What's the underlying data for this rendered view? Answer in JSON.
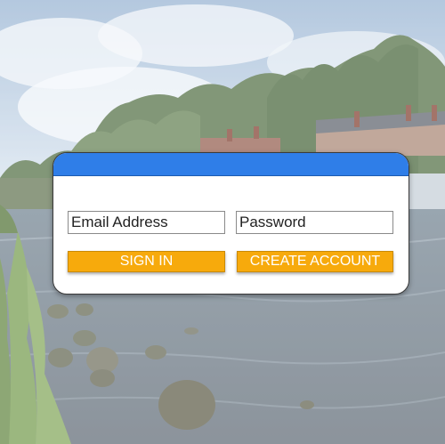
{
  "login": {
    "email_placeholder": "Email Address",
    "password_placeholder": "Password",
    "sign_in_label": "SIGN IN",
    "create_account_label": "CREATE ACCOUNT"
  },
  "colors": {
    "header_accent": "#2f7ee8",
    "button": "#f7aa0c",
    "button_text": "#ffffff"
  }
}
